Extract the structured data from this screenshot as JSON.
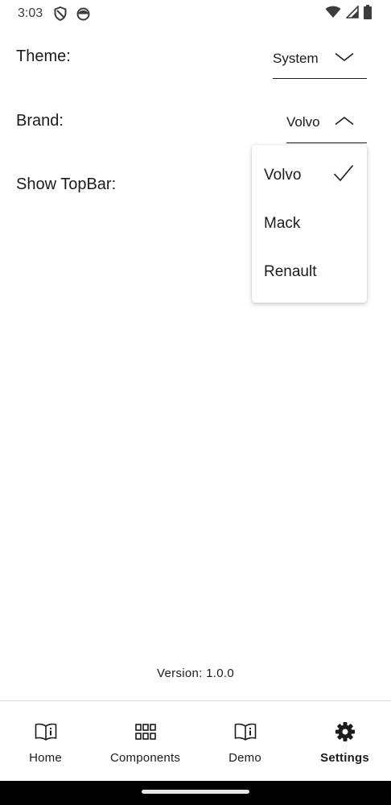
{
  "status_bar": {
    "time": "3:03",
    "left_icons": [
      "shield-icon",
      "notification-face-icon"
    ],
    "right_icons": [
      "wifi-icon",
      "cell-signal-icon",
      "battery-icon"
    ]
  },
  "settings": {
    "theme": {
      "label": "Theme:",
      "value": "System"
    },
    "brand": {
      "label": "Brand:",
      "value": "Volvo",
      "expanded": true
    },
    "topbar": {
      "label": "Show TopBar:"
    }
  },
  "brand_menu": {
    "items": [
      {
        "label": "Volvo",
        "selected": true
      },
      {
        "label": "Mack",
        "selected": false
      },
      {
        "label": "Renault",
        "selected": false
      }
    ]
  },
  "version": "Version: 1.0.0",
  "bottom_nav": {
    "items": [
      {
        "label": "Home",
        "icon": "book-info-icon",
        "active": false
      },
      {
        "label": "Components",
        "icon": "grid-icon",
        "active": false
      },
      {
        "label": "Demo",
        "icon": "book-info-icon",
        "active": false
      },
      {
        "label": "Settings",
        "icon": "gear-icon",
        "active": true
      }
    ]
  },
  "colors": {
    "text": "#1b1b1b",
    "divider": "#d9d9d9",
    "gesture_bar": "#000000"
  }
}
